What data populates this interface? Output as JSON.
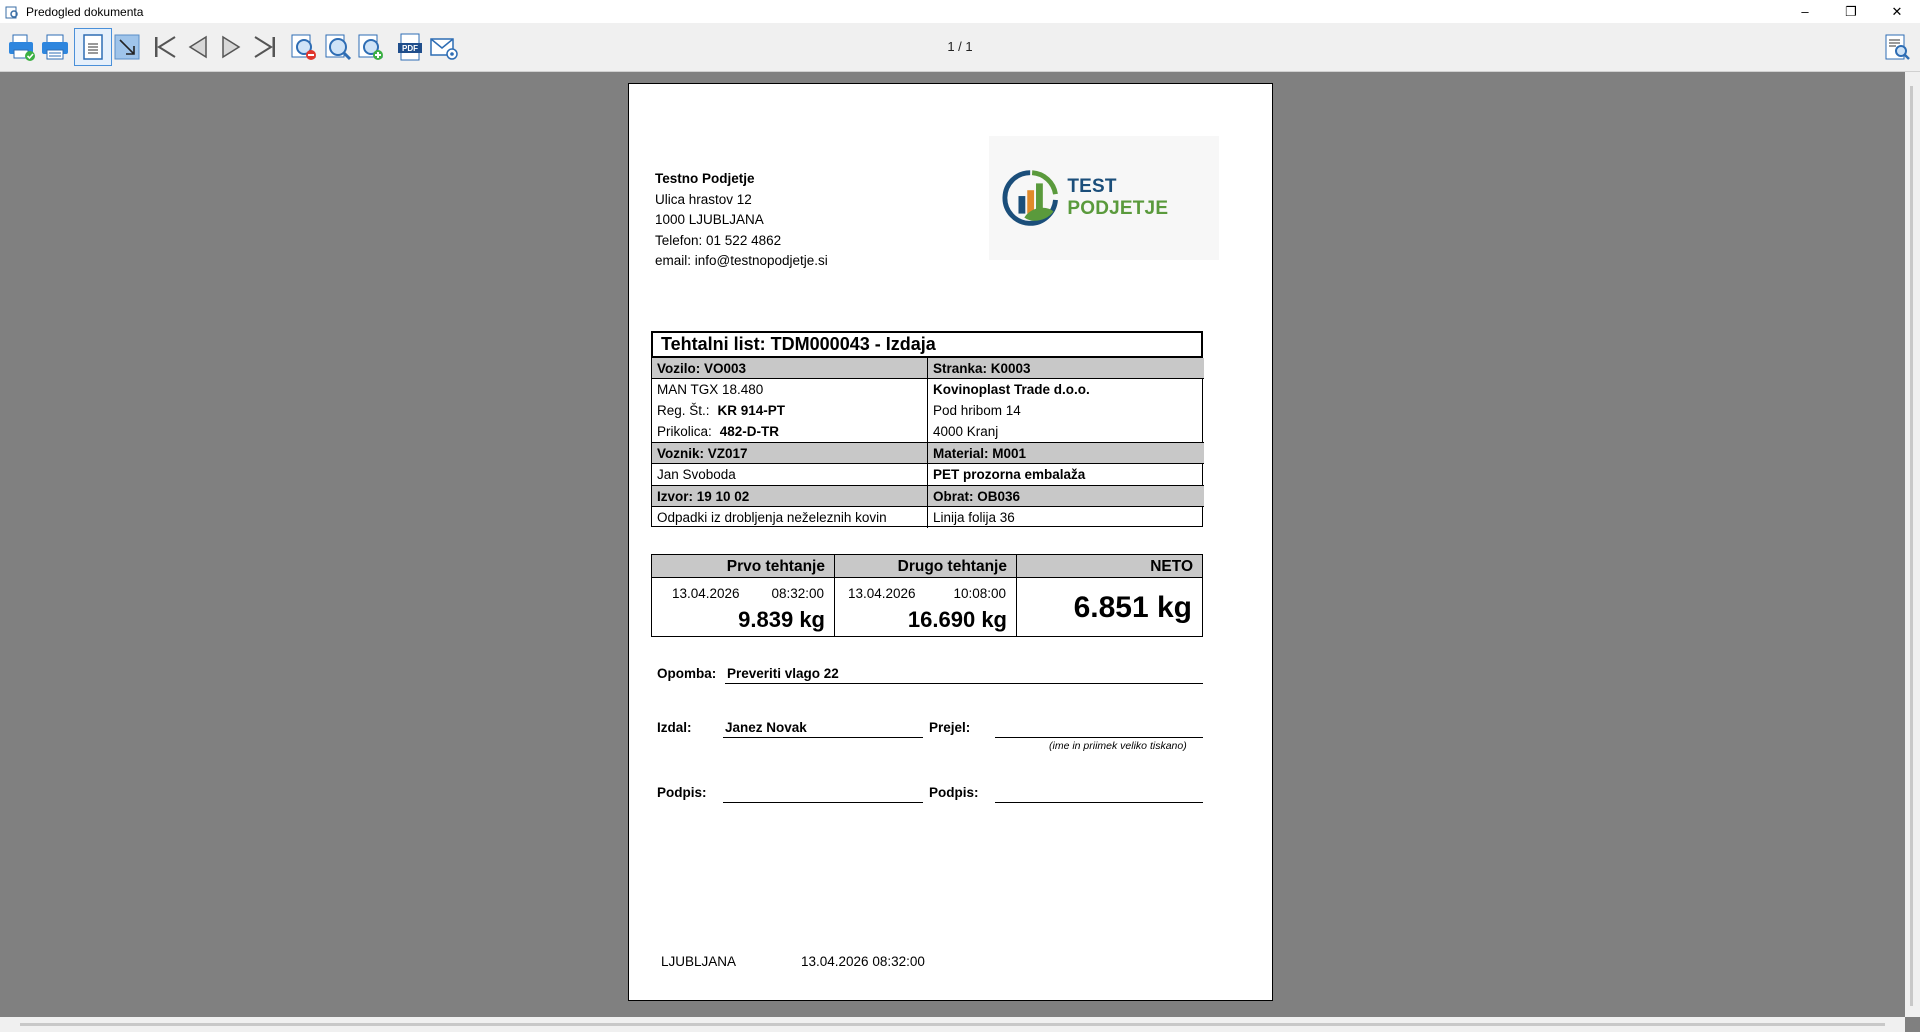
{
  "window": {
    "title": "Predogled dokumenta",
    "minimize": "–",
    "restore": "❐",
    "close": "✕"
  },
  "toolbar": {
    "buttons": [
      "print-setup-icon",
      "print-icon",
      "page-layout-icon",
      "fit-page-icon",
      "first-page-icon",
      "prev-page-icon",
      "next-page-icon",
      "last-page-icon",
      "zoom-out-icon",
      "zoom-icon",
      "zoom-in-icon",
      "pdf-icon",
      "email-icon",
      "search-doc-icon"
    ],
    "page_indicator": "1 / 1"
  },
  "document": {
    "company": {
      "name": "Testno Podjetje",
      "street": "Ulica hrastov 12",
      "city": "1000 LJUBLJANA",
      "phone": "Telefon: 01 522 4862",
      "email": "email: info@testnopodjetje.si"
    },
    "logo": {
      "text_a": "TEST ",
      "text_b": "PODJETJE",
      "colors": [
        "#1b4e7a",
        "#5a9a3c",
        "#e08a2a"
      ]
    },
    "title": "Tehtalni list: TDM000043 - Izdaja",
    "vehicle": {
      "header": "Vozilo: VO003",
      "model": "MAN TGX 18.480",
      "reg_label": "Reg. Št.:",
      "reg_value": "KR 914-PT",
      "trailer_label": "Prikolica:",
      "trailer_value": "482-D-TR"
    },
    "customer": {
      "header": "Stranka: K0003",
      "name": "Kovinoplast Trade d.o.o.",
      "street": "Pod hribom 14",
      "city": "4000 Kranj"
    },
    "driver": {
      "header": "Voznik: VZ017",
      "name": "Jan Svoboda"
    },
    "material": {
      "header": "Material: M001",
      "name": "PET prozorna embalaža"
    },
    "source": {
      "header": "Izvor: 19 10 02",
      "name": "Odpadki iz drobljenja neželeznih kovin"
    },
    "plant": {
      "header": "Obrat: OB036",
      "name": "Linija folija 36"
    },
    "weighing": {
      "first": {
        "label": "Prvo tehtanje",
        "date": "13.04.2026",
        "time": "08:32:00",
        "value": "9.839 kg"
      },
      "second": {
        "label": "Drugo tehtanje",
        "date": "13.04.2026",
        "time": "10:08:00",
        "value": "16.690 kg"
      },
      "net": {
        "label": "NETO",
        "value": "6.851 kg"
      }
    },
    "note": {
      "label": "Opomba:",
      "value": "Preveriti vlago 22"
    },
    "issued": {
      "label": "Izdal:",
      "value": "Janez Novak"
    },
    "received": {
      "label": "Prejel:",
      "value": "",
      "hint": "(ime in priimek veliko tiskano)"
    },
    "signature_left": "Podpis:",
    "signature_right": "Podpis:",
    "footer": {
      "city": "LJUBLJANA",
      "datetime": "13.04.2026 08:32:00"
    }
  }
}
